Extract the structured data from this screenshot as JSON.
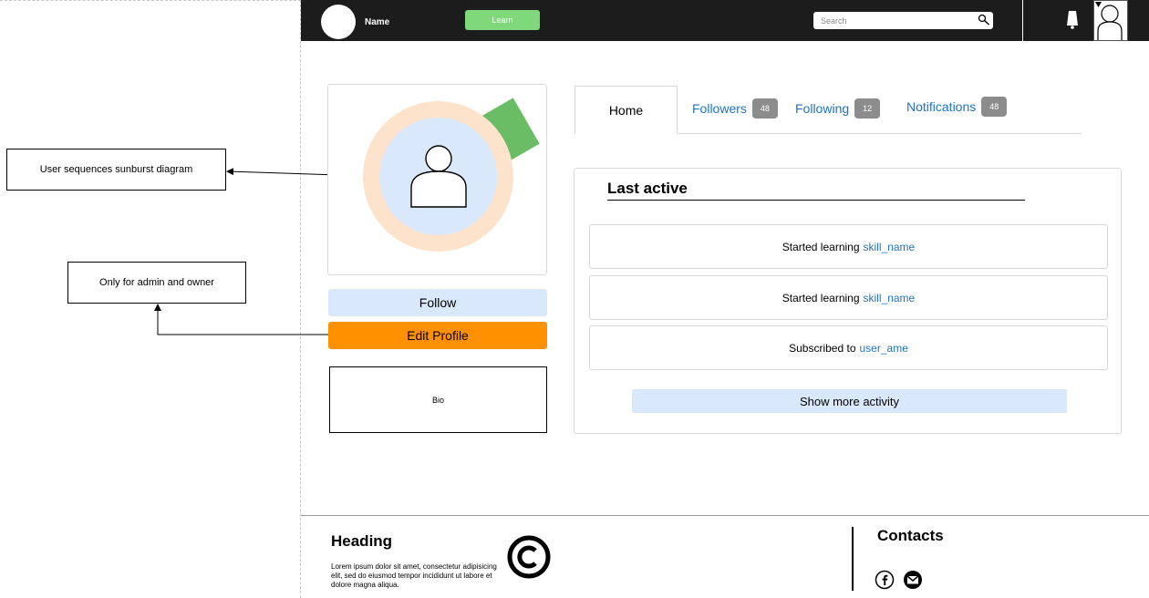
{
  "annotations": {
    "sunburst_note": "User sequences sunburst diagram",
    "admin_note": "Only for admin and owner"
  },
  "navbar": {
    "name": "Name",
    "learn_label": "Learn",
    "search_placeholder": "Search",
    "icons": [
      "logo-circle",
      "search-icon",
      "bell-icon",
      "user-avatar-icon",
      "caret-down-icon"
    ],
    "learn_color": "#7fd97a",
    "background": "#1c1c1c"
  },
  "profile": {
    "follow_label": "Follow",
    "edit_label": "Edit Profile",
    "bio": "Bio",
    "colors": {
      "ring": "#fde3cc",
      "inner": "#dae8fc",
      "wedge": "#6bbd65",
      "follow": "#dae8fc",
      "edit": "#ff9000"
    }
  },
  "tabs": [
    {
      "label": "Home"
    },
    {
      "label": "Followers",
      "count": "48"
    },
    {
      "label": "Following",
      "count": "12"
    },
    {
      "label": "Notifications",
      "count": "48"
    }
  ],
  "activity": {
    "title": "Last active",
    "items": [
      {
        "text": "Started learning",
        "link": "skill_name"
      },
      {
        "text": "Started learning",
        "link": "skill_name"
      },
      {
        "text": "Subscribed to",
        "link": "user_ame"
      }
    ],
    "show_more_label": "Show more activity",
    "link_color": "#1e73c8"
  },
  "footer": {
    "heading": "Heading",
    "text": "Lorem ipsum dolor sit amet, consectetur adipisicing elit, sed do eiusmod tempor incididunt ut labore et dolore magna aliqua.",
    "contacts_heading": "Contacts",
    "icons": [
      "copyright-icon",
      "facebook-icon",
      "mail-icon"
    ]
  }
}
